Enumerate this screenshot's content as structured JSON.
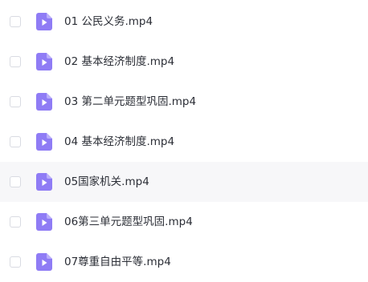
{
  "files": [
    {
      "name": "01 公民义务.mp4",
      "icon": "video-file-icon"
    },
    {
      "name": "02 基本经济制度.mp4",
      "icon": "video-file-icon"
    },
    {
      "name": "03 第二单元题型巩固.mp4",
      "icon": "video-file-icon"
    },
    {
      "name": "04 基本经济制度.mp4",
      "icon": "video-file-icon"
    },
    {
      "name": "05国家机关.mp4",
      "icon": "video-file-icon"
    },
    {
      "name": "06第三单元题型巩固.mp4",
      "icon": "video-file-icon"
    },
    {
      "name": "07尊重自由平等.mp4",
      "icon": "video-file-icon"
    }
  ],
  "colors": {
    "icon_purple": "#8f7cf5",
    "icon_fold": "#b9adfa",
    "row_hover": "#f7f7f9",
    "text": "#2b2e36"
  }
}
